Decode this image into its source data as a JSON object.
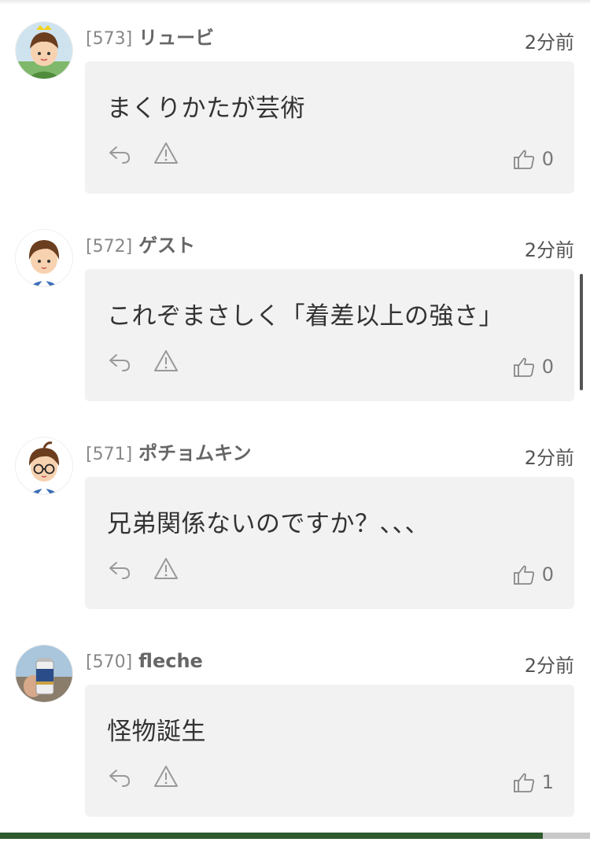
{
  "comments": [
    {
      "number": "[573]",
      "username": "リュービ",
      "time": "2分前",
      "text": "まくりかたが芸術",
      "likes": "0",
      "avatar": "avatar-boy-yellow-hat-icon"
    },
    {
      "number": "[572]",
      "username": "ゲスト",
      "time": "2分前",
      "text": "これぞまさしく「着差以上の強さ」",
      "likes": "0",
      "avatar": "avatar-boy-default-icon"
    },
    {
      "number": "[571]",
      "username": "ポチョムキン",
      "time": "2分前",
      "text": "兄弟関係ないのですか？、、、",
      "likes": "0",
      "avatar": "avatar-boy-glasses-icon"
    },
    {
      "number": "[570]",
      "username": "fleche",
      "time": "2分前",
      "text": "怪物誕生",
      "likes": "1",
      "avatar": "avatar-photo-beer-can-icon"
    }
  ],
  "icons": {
    "reply": "reply-icon",
    "report": "warning-triangle-icon",
    "like": "thumbs-up-icon"
  },
  "colors": {
    "card_bg": "#f2f2f2",
    "username": "#666666",
    "meta": "#888888",
    "bottom_bar": "#2e5a2e"
  }
}
